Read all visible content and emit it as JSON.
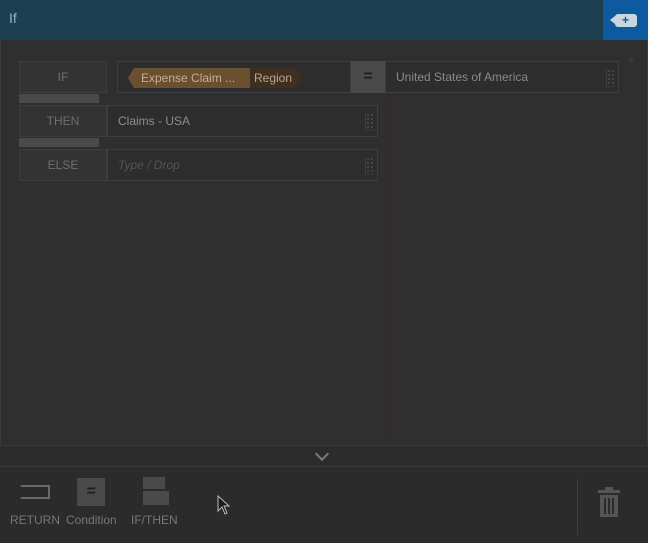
{
  "window": {
    "title": "If",
    "action_icon": "add-tag-icon",
    "action_glyph": "+"
  },
  "rows": {
    "if": {
      "label": "IF",
      "entity_tag": "Expense Claim ...",
      "attribute_tag": "Region",
      "operator": "=",
      "value": "United States of America"
    },
    "then": {
      "label": "THEN",
      "value": "Claims - USA"
    },
    "else": {
      "label": "ELSE",
      "placeholder": "Type / Drop"
    }
  },
  "toolbar": {
    "return_label": "RETURN",
    "condition_label": "Condition",
    "condition_glyph": "=",
    "ifthen_label": "IF/THEN"
  },
  "colors": {
    "titlebar": "#1c3f52",
    "accent_button": "#0d5a9e",
    "entity_tag": "#6a5030",
    "attribute_tag": "#3f2f20"
  }
}
